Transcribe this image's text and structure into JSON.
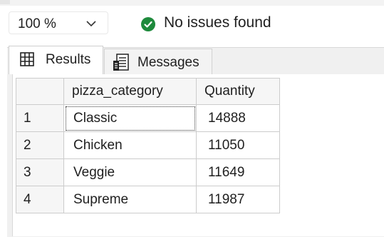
{
  "toolbar": {
    "zoom_value": "100 %",
    "status_text": "No issues found",
    "status_color": "#1e8a3c"
  },
  "tabs": [
    {
      "label": "Results",
      "icon": "grid-icon",
      "active": true
    },
    {
      "label": "Messages",
      "icon": "messages-icon",
      "active": false
    }
  ],
  "grid": {
    "columns": [
      "pizza_category",
      "Quantity"
    ],
    "rows": [
      {
        "num": "1",
        "pizza_category": "Classic",
        "Quantity": "14888"
      },
      {
        "num": "2",
        "pizza_category": "Chicken",
        "Quantity": "11050"
      },
      {
        "num": "3",
        "pizza_category": "Veggie",
        "Quantity": "11649"
      },
      {
        "num": "4",
        "pizza_category": "Supreme",
        "Quantity": "11987"
      }
    ]
  }
}
